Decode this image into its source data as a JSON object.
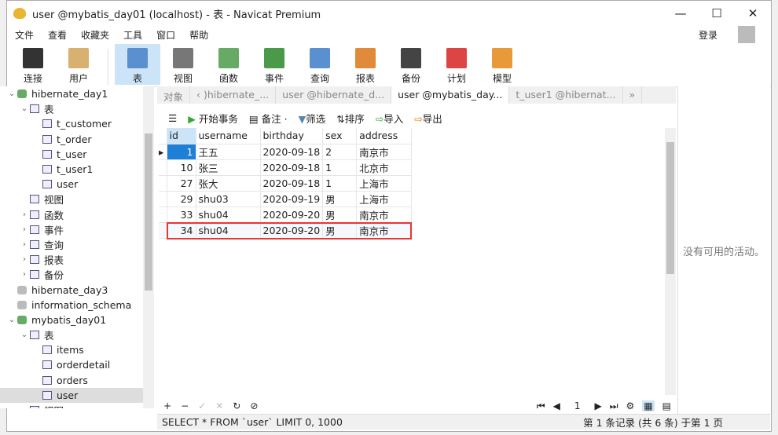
{
  "window": {
    "title": "user @mybatis_day01 (localhost) - 表 - Navicat Premium",
    "controls": [
      "—",
      "☐",
      "✕"
    ]
  },
  "menu": [
    "文件",
    "查看",
    "收藏夹",
    "工具",
    "窗口",
    "帮助"
  ],
  "login": "登录",
  "toolbar": [
    {
      "label": "连接",
      "icon": "plug-icon",
      "color": "#333"
    },
    {
      "label": "用户",
      "icon": "user-icon",
      "color": "#d8b070"
    },
    {
      "label": "表",
      "icon": "table-icon",
      "color": "#5a8fd0",
      "active": true
    },
    {
      "label": "视图",
      "icon": "view-icon",
      "color": "#777"
    },
    {
      "label": "函数",
      "icon": "function-icon",
      "color": "#6a6"
    },
    {
      "label": "事件",
      "icon": "event-icon",
      "color": "#4a9a4a"
    },
    {
      "label": "查询",
      "icon": "query-icon",
      "color": "#5a8fd0"
    },
    {
      "label": "报表",
      "icon": "report-icon",
      "color": "#e08a3a"
    },
    {
      "label": "备份",
      "icon": "backup-icon",
      "color": "#444"
    },
    {
      "label": "计划",
      "icon": "schedule-icon",
      "color": "#d44"
    },
    {
      "label": "模型",
      "icon": "model-icon",
      "color": "#e89a3a"
    }
  ],
  "tree": [
    {
      "label": "hibernate_day1",
      "level": 0,
      "arrow": "⌄",
      "type": "db"
    },
    {
      "label": "表",
      "level": 1,
      "arrow": "⌄",
      "type": "tbl"
    },
    {
      "label": "t_customer",
      "level": 2,
      "type": "tbl"
    },
    {
      "label": "t_order",
      "level": 2,
      "type": "tbl"
    },
    {
      "label": "t_user",
      "level": 2,
      "type": "tbl"
    },
    {
      "label": "t_user1",
      "level": 2,
      "type": "tbl"
    },
    {
      "label": "user",
      "level": 2,
      "type": "tbl"
    },
    {
      "label": "视图",
      "level": 1,
      "type": "view"
    },
    {
      "label": "函数",
      "level": 1,
      "arrow": "›",
      "type": "fn"
    },
    {
      "label": "事件",
      "level": 1,
      "arrow": "›",
      "type": "ev"
    },
    {
      "label": "查询",
      "level": 1,
      "arrow": "›",
      "type": "q"
    },
    {
      "label": "报表",
      "level": 1,
      "arrow": "›",
      "type": "r"
    },
    {
      "label": "备份",
      "level": 1,
      "arrow": "›",
      "type": "b"
    },
    {
      "label": "hibernate_day3",
      "level": 0,
      "type": "dbg"
    },
    {
      "label": "information_schema",
      "level": 0,
      "type": "dbg"
    },
    {
      "label": "mybatis_day01",
      "level": 0,
      "arrow": "⌄",
      "type": "db"
    },
    {
      "label": "表",
      "level": 1,
      "arrow": "⌄",
      "type": "tbl"
    },
    {
      "label": "items",
      "level": 2,
      "type": "tbl"
    },
    {
      "label": "orderdetail",
      "level": 2,
      "type": "tbl"
    },
    {
      "label": "orders",
      "level": 2,
      "type": "tbl"
    },
    {
      "label": "user",
      "level": 2,
      "type": "tbl",
      "selected": true
    },
    {
      "label": "视图",
      "level": 1,
      "arrow": "›",
      "type": "view"
    }
  ],
  "tabs": [
    {
      "label": "对象"
    },
    {
      "label": "‹ )hibernate_..."
    },
    {
      "label": "user @hibernate_d..."
    },
    {
      "label": "user @mybatis_day...",
      "active": true
    },
    {
      "label": "t_user1 @hibernat..."
    },
    {
      "label": "»"
    }
  ],
  "subtoolbar": {
    "menu": "☰",
    "begin": "开始事务",
    "note": "备注 ·",
    "filter": "筛选",
    "sort": "排序",
    "import": "导入",
    "export": "导出"
  },
  "grid": {
    "columns": [
      "id",
      "username",
      "birthday",
      "sex",
      "address"
    ],
    "rows": [
      [
        "1",
        "王五",
        "2020-09-18",
        "2",
        "南京市"
      ],
      [
        "10",
        "张三",
        "2020-09-18",
        "1",
        "北京市"
      ],
      [
        "27",
        "张大",
        "2020-09-18",
        "1",
        "上海市"
      ],
      [
        "29",
        "shu03",
        "2020-09-19",
        "男",
        "上海市"
      ],
      [
        "33",
        "shu04",
        "2020-09-20",
        "男",
        "南京市"
      ],
      [
        "34",
        "shu04",
        "2020-09-20",
        "男",
        "南京市"
      ]
    ]
  },
  "right_panel": "没有可用的活动。",
  "bottom": {
    "actions": [
      "+",
      "−",
      "✓",
      "✕",
      "↻",
      "⊘"
    ],
    "page": "1"
  },
  "status": {
    "sql": "SELECT * FROM `user` LIMIT 0, 1000",
    "records": "第 1 条记录 (共 6 条) 于第 1 页"
  }
}
